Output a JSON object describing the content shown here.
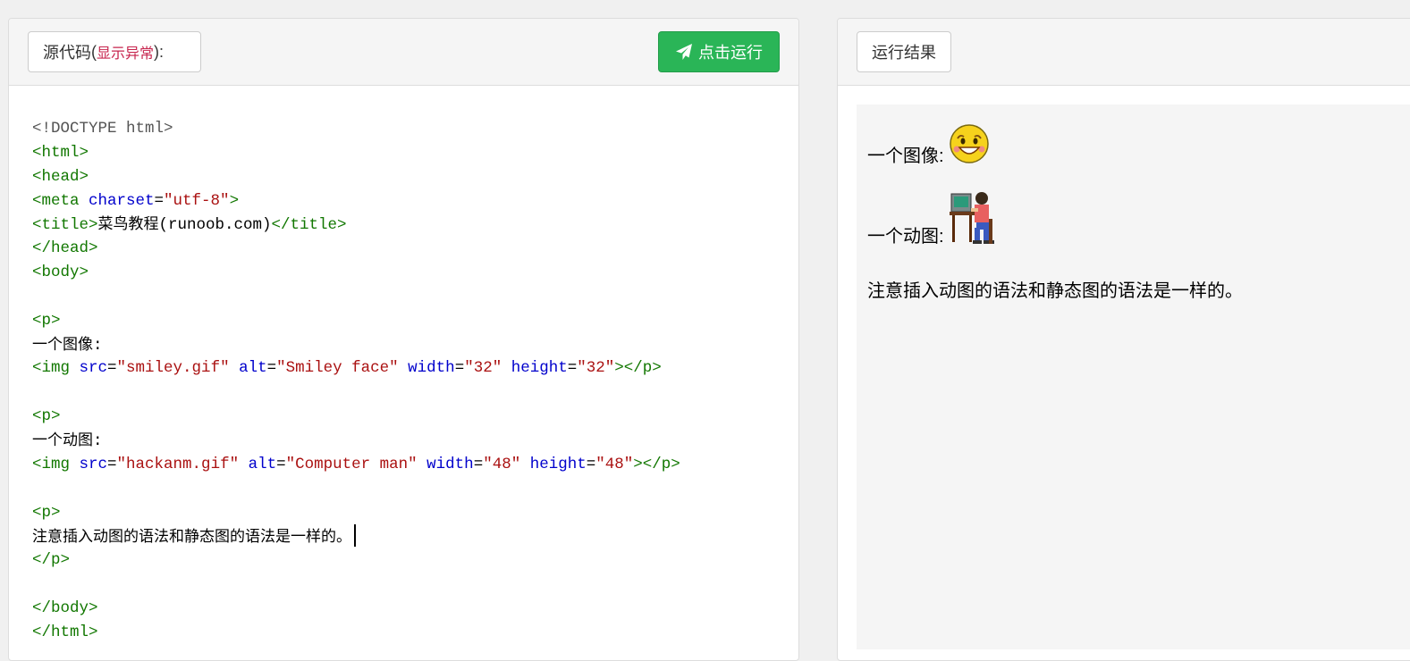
{
  "left_panel": {
    "title": "源代码",
    "title_open": " (",
    "anomaly_link": "显示异常",
    "title_close": "):",
    "run_label": "点击运行",
    "run_icon": "paper-plane-icon"
  },
  "right_panel": {
    "title": "运行结果"
  },
  "colors": {
    "run_button": "#2ab557",
    "anomaly_link": "#c7254e",
    "tag": "#117700",
    "attribute": "#0000cc",
    "string": "#aa1111",
    "doctype": "#555555"
  },
  "code_lines": [
    [
      {
        "c": "doc",
        "t": "<!DOCTYPE html>"
      }
    ],
    [
      {
        "c": "tag",
        "t": "<html>"
      }
    ],
    [
      {
        "c": "tag",
        "t": "<head>"
      }
    ],
    [
      {
        "c": "tag",
        "t": "<meta "
      },
      {
        "c": "attr",
        "t": "charset"
      },
      {
        "c": "txt",
        "t": "="
      },
      {
        "c": "str",
        "t": "\"utf-8\""
      },
      {
        "c": "tag",
        "t": ">"
      }
    ],
    [
      {
        "c": "tag",
        "t": "<title>"
      },
      {
        "c": "cjk",
        "t": "菜鸟教程"
      },
      {
        "c": "txt",
        "t": "(runoob.com)"
      },
      {
        "c": "tag",
        "t": "</title>"
      }
    ],
    [
      {
        "c": "tag",
        "t": "</head>"
      }
    ],
    [
      {
        "c": "tag",
        "t": "<body>"
      }
    ],
    [],
    [
      {
        "c": "tag",
        "t": "<p>"
      }
    ],
    [
      {
        "c": "cjk",
        "t": "一个图像"
      },
      {
        "c": "txt",
        "t": ":"
      }
    ],
    [
      {
        "c": "tag",
        "t": "<img "
      },
      {
        "c": "attr",
        "t": "src"
      },
      {
        "c": "txt",
        "t": "="
      },
      {
        "c": "str",
        "t": "\"smiley.gif\""
      },
      {
        "c": "txt",
        "t": " "
      },
      {
        "c": "attr",
        "t": "alt"
      },
      {
        "c": "txt",
        "t": "="
      },
      {
        "c": "str",
        "t": "\"Smiley face\""
      },
      {
        "c": "txt",
        "t": " "
      },
      {
        "c": "attr",
        "t": "width"
      },
      {
        "c": "txt",
        "t": "="
      },
      {
        "c": "str",
        "t": "\"32\""
      },
      {
        "c": "txt",
        "t": " "
      },
      {
        "c": "attr",
        "t": "height"
      },
      {
        "c": "txt",
        "t": "="
      },
      {
        "c": "str",
        "t": "\"32\""
      },
      {
        "c": "tag",
        "t": "></p>"
      }
    ],
    [],
    [
      {
        "c": "tag",
        "t": "<p>"
      }
    ],
    [
      {
        "c": "cjk",
        "t": "一个动图"
      },
      {
        "c": "txt",
        "t": ":"
      }
    ],
    [
      {
        "c": "tag",
        "t": "<img "
      },
      {
        "c": "attr",
        "t": "src"
      },
      {
        "c": "txt",
        "t": "="
      },
      {
        "c": "str",
        "t": "\"hackanm.gif\""
      },
      {
        "c": "txt",
        "t": " "
      },
      {
        "c": "attr",
        "t": "alt"
      },
      {
        "c": "txt",
        "t": "="
      },
      {
        "c": "str",
        "t": "\"Computer man\""
      },
      {
        "c": "txt",
        "t": " "
      },
      {
        "c": "attr",
        "t": "width"
      },
      {
        "c": "txt",
        "t": "="
      },
      {
        "c": "str",
        "t": "\"48\""
      },
      {
        "c": "txt",
        "t": " "
      },
      {
        "c": "attr",
        "t": "height"
      },
      {
        "c": "txt",
        "t": "="
      },
      {
        "c": "str",
        "t": "\"48\""
      },
      {
        "c": "tag",
        "t": "></p>"
      }
    ],
    [],
    [
      {
        "c": "tag",
        "t": "<p>"
      }
    ],
    [
      {
        "c": "cjk",
        "t": "注意插入动图的语法和静态图的语法是一样的。"
      },
      {
        "c": "caret",
        "t": ""
      }
    ],
    [
      {
        "c": "tag",
        "t": "</p>"
      }
    ],
    [],
    [
      {
        "c": "tag",
        "t": "</body>"
      }
    ],
    [
      {
        "c": "tag",
        "t": "</html>"
      }
    ]
  ],
  "result": {
    "p1": "一个图像:",
    "p1_image": "smiley-face-icon",
    "p2": "一个动图:",
    "p2_image": "computer-man-icon",
    "p3": "注意插入动图的语法和静态图的语法是一样的。"
  }
}
